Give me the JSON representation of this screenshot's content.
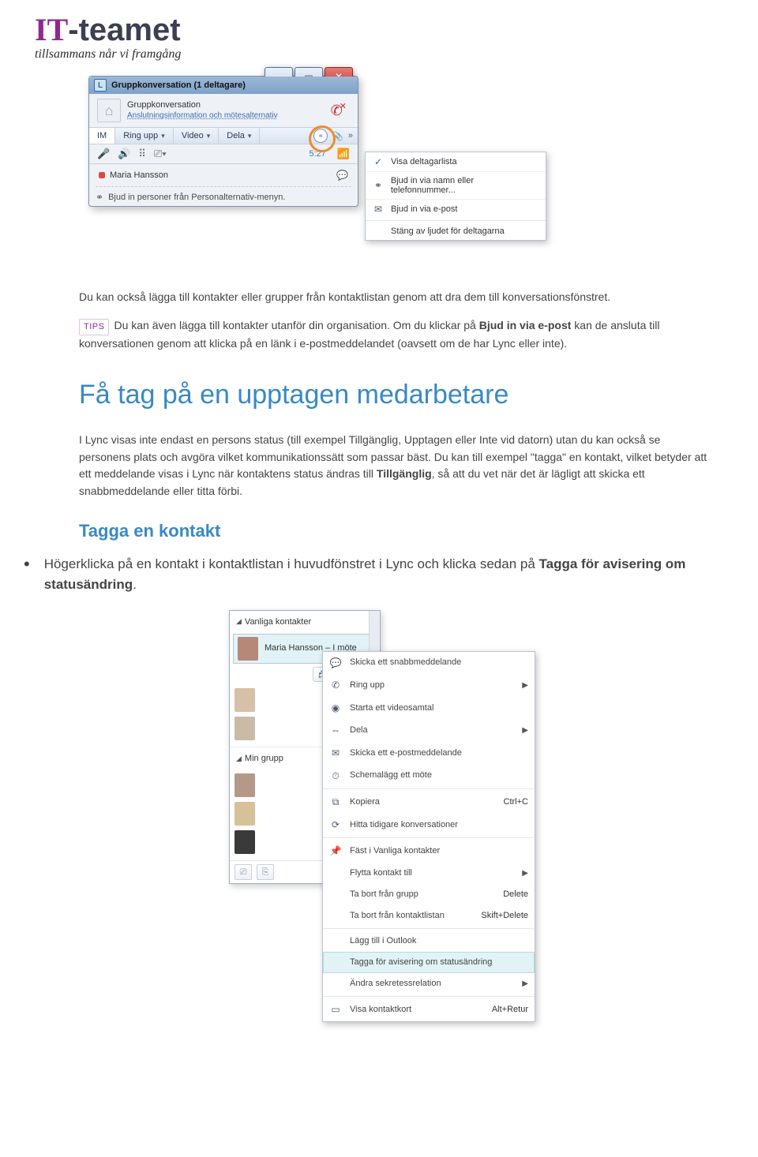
{
  "brand": {
    "it": "IT",
    "rest": "-teamet",
    "sub": "tillsammans når vi framgång"
  },
  "shot1": {
    "title": "Gruppkonversation (1 deltagare)",
    "head": {
      "t1": "Gruppkonversation",
      "t2": "Anslutningsinformation och mötesalternativ"
    },
    "modes": {
      "im": "IM",
      "ring": "Ring upp",
      "video": "Video",
      "share": "Dela"
    },
    "mode_end_more": "»",
    "time": "5:27",
    "participant": "Maria Hansson",
    "invite": "Bjud in personer från Personalternativ-menyn.",
    "menu": {
      "show_list": "Visa deltagarlista",
      "invite_name": "Bjud in via namn eller telefonnummer...",
      "invite_mail": "Bjud in via e-post",
      "mute": "Stäng av ljudet för deltagarna"
    }
  },
  "para1": "Du kan också lägga till kontakter eller grupper från kontaktlistan genom att dra dem till konversationsfönstret.",
  "tips_label": "TIPS",
  "para2a": "Du kan även lägga till kontakter utanför din organisation. Om du klickar på ",
  "para2b": "Bjud in via e-post",
  "para2c": " kan de ansluta till konversationen genom att klicka på en länk i e-postmeddelandet (oavsett om de har Lync eller inte).",
  "h1": "Få tag på en upptagen medarbetare",
  "para3a": "I Lync visas inte endast en persons status (till exempel Tillgänglig, Upptagen eller Inte vid datorn) utan du kan också se personens plats och avgöra vilket kommunikationssätt som passar bäst. Du kan till exempel \"tagga\" en kontakt, vilket betyder att ett meddelande visas i Lync när kontaktens status ändras till ",
  "para3b": "Tillgänglig",
  "para3c": ", så att du vet när det är lägligt att skicka ett snabbmeddelande eller titta förbi.",
  "h2": "Tagga en kontakt",
  "bullet_a": "Högerklicka på en kontakt i kontaktlistan i huvudfönstret i Lync och klicka sedan på ",
  "bullet_b": "Tagga för avisering om statusändring",
  "bullet_c": ".",
  "shot2": {
    "group1": "Vanliga kontakter",
    "selected": {
      "name": "Maria Hansson – I möte",
      "ring": "Ring upp"
    },
    "group2": "Min grupp",
    "ctx": {
      "im": "Skicka ett snabbmeddelande",
      "call": "Ring upp",
      "video": "Starta ett videosamtal",
      "share": "Dela",
      "mail": "Skicka ett e-postmeddelande",
      "meet": "Schemalägg ett möte",
      "copy": "Kopiera",
      "copy_sc": "Ctrl+C",
      "find": "Hitta tidigare konversationer",
      "pin": "Fäst i Vanliga kontakter",
      "move": "Flytta kontakt till",
      "rem_grp": "Ta bort från grupp",
      "rem_grp_sc": "Delete",
      "rem_list": "Ta bort från kontaktlistan",
      "rem_list_sc": "Skift+Delete",
      "outlook": "Lägg till i Outlook",
      "tag": "Tagga för avisering om statusändring",
      "privacy": "Ändra sekretessrelation",
      "card": "Visa kontaktkort",
      "card_sc": "Alt+Retur"
    }
  }
}
